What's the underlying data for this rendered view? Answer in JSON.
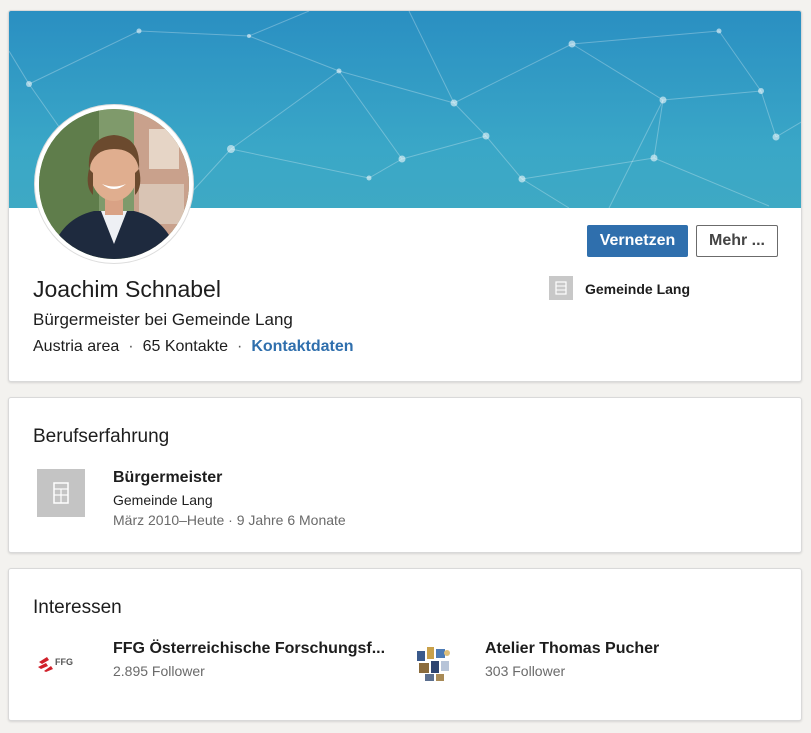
{
  "profile": {
    "name": "Joachim Schnabel",
    "headline": "Bürgermeister bei Gemeinde Lang",
    "location": "Austria area",
    "connections": "65 Kontakte",
    "separator": "·",
    "contact_link": "Kontaktdaten",
    "connect_button": "Vernetzen",
    "more_button": "Mehr ...",
    "current_company": "Gemeinde Lang"
  },
  "experience": {
    "title": "Berufserfahrung",
    "items": [
      {
        "role": "Bürgermeister",
        "company": "Gemeinde Lang",
        "dates": "März 2010–Heute · 9 Jahre 6 Monate",
        "logo_icon": "building-icon"
      }
    ]
  },
  "interests": {
    "title": "Interessen",
    "items": [
      {
        "name": "FFG Österreichische Forschungsf...",
        "followers": "2.895 Follower",
        "logo_icon": "ffg-logo",
        "logo_text": "FFG"
      },
      {
        "name": "Atelier Thomas Pucher",
        "followers": "303 Follower",
        "logo_icon": "atelier-logo"
      }
    ]
  },
  "colors": {
    "accent": "#2f6fad",
    "banner": "#3aa7c7"
  }
}
